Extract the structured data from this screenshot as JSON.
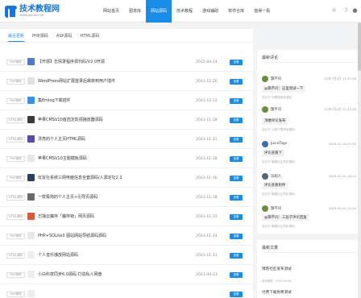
{
  "header": {
    "logo_title": "技术教程网",
    "logo_sub": "WWW.JSJCW.COM",
    "nav": [
      {
        "label": "网站首页",
        "active": false
      },
      {
        "label": "图意库",
        "active": false
      },
      {
        "label": "网站源码",
        "active": true
      },
      {
        "label": "技术教程",
        "active": false
      },
      {
        "label": "游戏辅助",
        "active": false
      },
      {
        "label": "软件仓库",
        "active": false
      },
      {
        "label": "值得一看",
        "active": false
      }
    ]
  },
  "tabs": [
    {
      "label": "最近更新",
      "active": true
    },
    {
      "label": "PHP源码",
      "active": false
    },
    {
      "label": "ASP源码",
      "active": false
    },
    {
      "label": "HTML源码",
      "active": false
    }
  ],
  "list": [
    {
      "category": "PHP源码",
      "title": "【开源】忘情录程序源代码/V2.0开源",
      "date": "2022-04-14",
      "button": "查看",
      "thumb_color": "#4f79c7"
    },
    {
      "category": "PHP源码",
      "title": "WordPress网站扩展登录后跳转到用户插件",
      "date": "2021-12-26",
      "button": "查看",
      "thumb_color": "#e0e0e0"
    },
    {
      "category": "PHP源码",
      "title": "集Emlog下载插件",
      "date": "2021-12-12",
      "button": "查看",
      "thumb_color": "#3d8fe0"
    },
    {
      "category": "HTML源码",
      "title": "苹果CMSV10首选定影视播放器源码",
      "date": "2021-11-28",
      "button": "查看",
      "thumb_color": "#3a3a3a"
    },
    {
      "category": "HTML源码",
      "title": "漂亮的个人主页HTML源码",
      "date": "2021-11-21",
      "button": "查看",
      "thumb_color": "#5b4aa8"
    },
    {
      "category": "PHP源码",
      "title": "苹果CMSV10主题模板源码",
      "date": "2021-11-18",
      "button": "查看",
      "thumb_color": "#e6e6e6"
    },
    {
      "category": "PHP源码",
      "title": "玩友社系统三网电脑信息全套源码/人源定址2.2",
      "date": "2021-11-16",
      "button": "查看",
      "thumb_color": "#2c3e5a"
    },
    {
      "category": "HTML源码",
      "title": "一款极简的个人主页+引导页源码",
      "date": "2021-11-18",
      "button": "查看",
      "thumb_color": "#6b6b6b"
    },
    {
      "category": "HTML源码",
      "title": "忘独云魔存「魔存锁」网页源码",
      "date": "2021-11-15",
      "button": "查看",
      "thumb_color": "#d95b3b"
    },
    {
      "category": "PHP源码",
      "title": "PHP+SQLite3 图站网站导航源码源码",
      "date": "2021-11-14",
      "button": "查看",
      "thumb_color": "#e8e8e8"
    },
    {
      "category": "HTML源码",
      "title": "个人音乐播放网站源码",
      "date": "2021-11-11",
      "button": "查看",
      "thumb_color": "#eeeeee"
    },
    {
      "category": "PHP源码",
      "title": "小白科技同步6.0源码 打造私人网盘",
      "date": "2021-09-23",
      "button": "查看",
      "thumb_color": "#eeeeee"
    },
    {
      "category": "PHP源码",
      "title": "",
      "date": "",
      "button": "查看",
      "thumb_color": "#eeeeee"
    }
  ],
  "sidebar": {
    "comments_title": "最新评论",
    "comments": [
      {
        "user": "飘不问",
        "time": "21年7月1日 21:47:46",
        "text": "@飘不问：这里测试一下",
        "source": "评论于 忘情录程序源码",
        "avatar_color": "#6a8f3a"
      },
      {
        "user": "飘不问",
        "time": "21年7月1日 21:47:46",
        "text": "顶楼评论发布",
        "source": "评论于 企鹅下载专用源码",
        "avatar_color": "#6a8f3a"
      },
      {
        "user": "JuiceTags",
        "time": "2023-02-16 21:04",
        "text": "评论查看下",
        "source": "评论于 奇趣社区发布源码",
        "avatar_color": "#3b6fb5"
      },
      {
        "user": "乐跑人",
        "time": "2023-02-20 12:14",
        "text": "评论查看附件",
        "source": "评论于 奇趣社区发布源码",
        "avatar_color": "#556677"
      },
      {
        "user": "飘不问",
        "time": "2023-03-20 12:04",
        "text": "@飘不问：三层子评论回复",
        "source": "评论于 奇趣社区发布源码",
        "avatar_color": "#6a8f3a"
      }
    ],
    "articles_title": "最新文章",
    "articles": [
      {
        "title": "博客社区发布测试",
        "meta": "技术教程 · 2023-03-08"
      },
      {
        "title": "付费下载免费测试",
        "meta": ""
      }
    ]
  }
}
